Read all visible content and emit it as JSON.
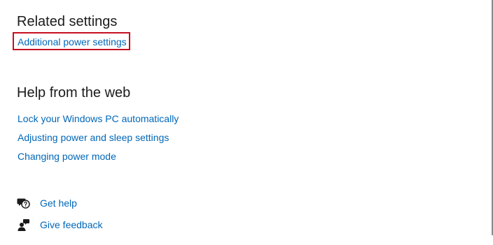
{
  "related": {
    "title": "Related settings",
    "additional_power": "Additional power settings"
  },
  "help": {
    "title": "Help from the web",
    "links": [
      "Lock your Windows PC automatically",
      "Adjusting power and sleep settings",
      "Changing power mode"
    ]
  },
  "footer": {
    "get_help": "Get help",
    "give_feedback": "Give feedback",
    "get_help_icon": "chat-help-icon",
    "give_feedback_icon": "feedback-person-icon"
  },
  "colors": {
    "link": "#0067b8",
    "highlight": "#c50f1f",
    "text": "#1b1b1b"
  }
}
